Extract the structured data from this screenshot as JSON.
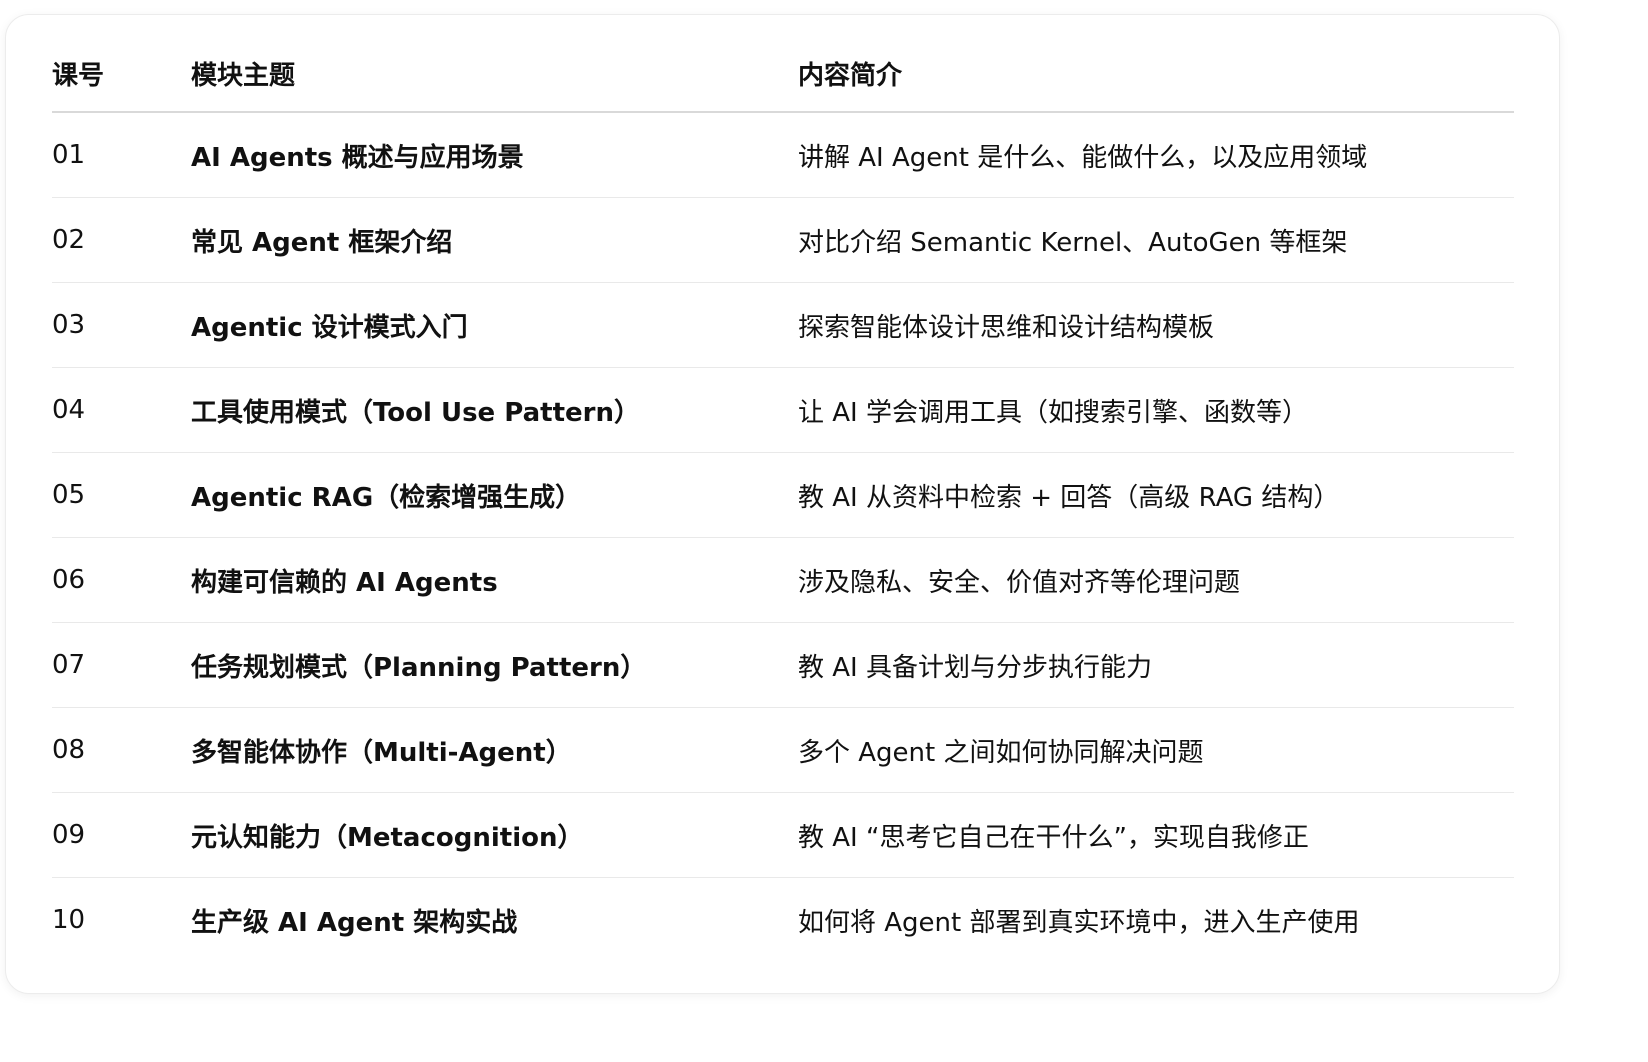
{
  "table": {
    "headers": {
      "num": "课号",
      "topic": "模块主题",
      "desc": "内容简介"
    },
    "rows": [
      {
        "num": "01",
        "topic": "AI Agents 概述与应用场景",
        "desc": "讲解 AI Agent 是什么、能做什么，以及应用领域"
      },
      {
        "num": "02",
        "topic": "常见 Agent 框架介绍",
        "desc": "对比介绍 Semantic Kernel、AutoGen 等框架"
      },
      {
        "num": "03",
        "topic": "Agentic 设计模式入门",
        "desc": "探索智能体设计思维和设计结构模板"
      },
      {
        "num": "04",
        "topic": "工具使用模式（Tool Use Pattern）",
        "desc": "让 AI 学会调用工具（如搜索引擎、函数等）"
      },
      {
        "num": "05",
        "topic": "Agentic RAG（检索增强生成）",
        "desc": "教 AI 从资料中检索 + 回答（高级 RAG 结构）"
      },
      {
        "num": "06",
        "topic": "构建可信赖的 AI Agents",
        "desc": "涉及隐私、安全、价值对齐等伦理问题"
      },
      {
        "num": "07",
        "topic": "任务规划模式（Planning Pattern）",
        "desc": "教 AI 具备计划与分步执行能力"
      },
      {
        "num": "08",
        "topic": "多智能体协作（Multi-Agent）",
        "desc": "多个 Agent 之间如何协同解决问题"
      },
      {
        "num": "09",
        "topic": "元认知能力（Metacognition）",
        "desc": "教 AI “思考它自己在干什么”，实现自我修正"
      },
      {
        "num": "10",
        "topic": "生产级 AI Agent 架构实战",
        "desc": "如何将 Agent 部署到真实环境中，进入生产使用"
      }
    ]
  }
}
